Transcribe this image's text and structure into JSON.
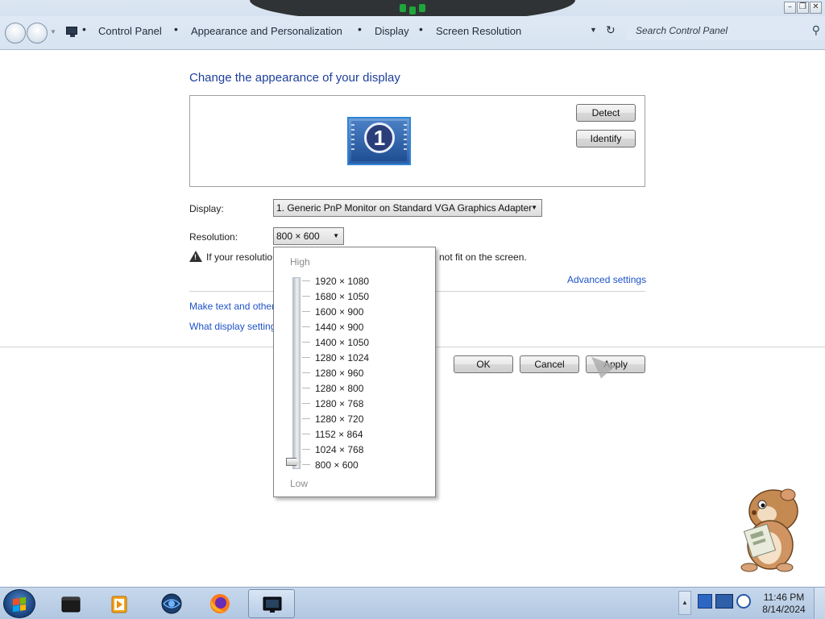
{
  "window": {
    "controls": {
      "minimize": "–",
      "restore": "❐",
      "close": "✕"
    }
  },
  "address_bar": {
    "crumbs": [
      "Control Panel",
      "Appearance and Personalization",
      "Display",
      "Screen Resolution"
    ],
    "separator": "•",
    "search_placeholder": "Search Control Panel"
  },
  "main": {
    "heading": "Change the appearance of your display",
    "monitor_number": "1",
    "detect_label": "Detect",
    "identify_label": "Identify",
    "display_label": "Display:",
    "display_value": "1. Generic PnP Monitor on Standard VGA Graphics Adapter",
    "resolution_label": "Resolution:",
    "resolution_value": "800 × 600",
    "warning_start": "If your resolutio",
    "warning_end": "not fit on the screen.",
    "advanced_link": "Advanced settings",
    "link_text_size": "Make text and other",
    "link_display_settings": "What display setting",
    "ok_label": "OK",
    "cancel_label": "Cancel",
    "apply_label": "Apply"
  },
  "resolution_dropdown": {
    "high_label": "High",
    "low_label": "Low",
    "options": [
      "1920 × 1080",
      "1680 × 1050",
      "1600 × 900",
      "1440 × 900",
      "1400 × 1050",
      "1280 × 1024",
      "1280 × 960",
      "1280 × 800",
      "1280 × 768",
      "1280 × 720",
      "1152 × 864",
      "1024 × 768",
      "800 × 600"
    ],
    "selected": "800 × 600"
  },
  "taskbar": {
    "apps": [
      "terminal-app-icon",
      "media-player-icon",
      "browser-globe-icon",
      "firefox-icon",
      "display-settings-icon"
    ],
    "active_app": "display-settings-icon",
    "time": "11:46 PM",
    "date": "8/14/2024"
  },
  "colors": {
    "heading": "#1e3f9b",
    "link": "#1e52c8",
    "taskbar": "#b9cde4"
  }
}
